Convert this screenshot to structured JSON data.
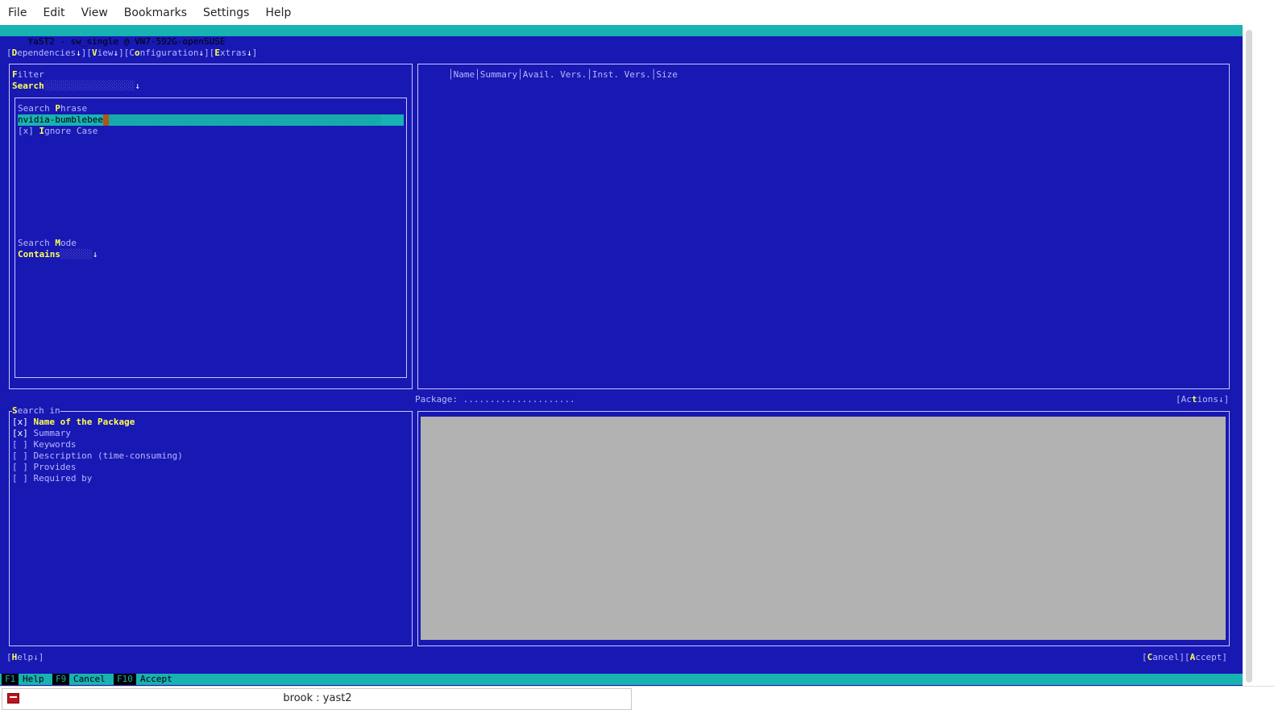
{
  "menubar": {
    "items": [
      "File",
      "Edit",
      "View",
      "Bookmarks",
      "Settings",
      "Help"
    ]
  },
  "terminal": {
    "title": "YaST2 - sw_single @ VN7-592G-openSUSE",
    "topmenu": {
      "dependencies": {
        "key": "D",
        "rest": "ependencies"
      },
      "view": {
        "key": "V",
        "rest": "iew"
      },
      "configuration": {
        "pre": "C",
        "key": "o",
        "rest": "nfiguration"
      },
      "extras": {
        "key": "E",
        "rest": "xtras"
      },
      "arrow": "↓"
    },
    "filter": {
      "label_key": "F",
      "label_rest": "ilter",
      "value": "Search",
      "arrow": "↓"
    },
    "search": {
      "phrase_label_pre": "Search ",
      "phrase_label_key": "P",
      "phrase_label_rest": "hrase",
      "phrase_value": "nvidia-bumblebee",
      "ignore_case_mark": "[x]",
      "ignore_case_key": "I",
      "ignore_case_rest": "gnore Case",
      "mode_label_pre": "Search ",
      "mode_label_key": "M",
      "mode_label_rest": "ode",
      "mode_value": "Contains",
      "arrow": "↓"
    },
    "table": {
      "columns": [
        "Name",
        "Summary",
        "Avail. Vers.",
        "Inst. Vers.",
        "Size"
      ]
    },
    "package": {
      "label": "Package: .....................",
      "actions_pre": "[Ac",
      "actions_key": "t",
      "actions_rest": "ions↓]"
    },
    "search_in": {
      "title_key": "S",
      "title_rest": "earch in",
      "items": [
        {
          "mark": "[x]",
          "label": "Name of the Package",
          "checked": true,
          "focused": true
        },
        {
          "mark": "[x]",
          "label": "Summary",
          "checked": true,
          "focused": false
        },
        {
          "mark": "[ ]",
          "label": "Keywords",
          "checked": false,
          "focused": false
        },
        {
          "mark": "[ ]",
          "label": "Description (time-consuming)",
          "checked": false,
          "focused": false
        },
        {
          "mark": "[ ]",
          "label": "Provides",
          "checked": false,
          "focused": false
        },
        {
          "mark": "[ ]",
          "label": "Required by",
          "checked": false,
          "focused": false
        }
      ]
    },
    "bottom": {
      "help_key": "H",
      "help_rest": "elp↓",
      "cancel_key": "C",
      "cancel_rest": "ancel",
      "accept_key": "A",
      "accept_rest": "ccept"
    },
    "fkeys": [
      {
        "key": "F1",
        "label": "Help"
      },
      {
        "key": "F9",
        "label": "Cancel"
      },
      {
        "key": "F10",
        "label": "Accept"
      }
    ]
  },
  "taskbar": {
    "task_label": "brook : yast2"
  },
  "colors": {
    "terminal_bg": "#1818b2",
    "title_bg": "#18b2b2",
    "hotkey": "#ffff54",
    "detail_pane": "#b2b2b2"
  }
}
